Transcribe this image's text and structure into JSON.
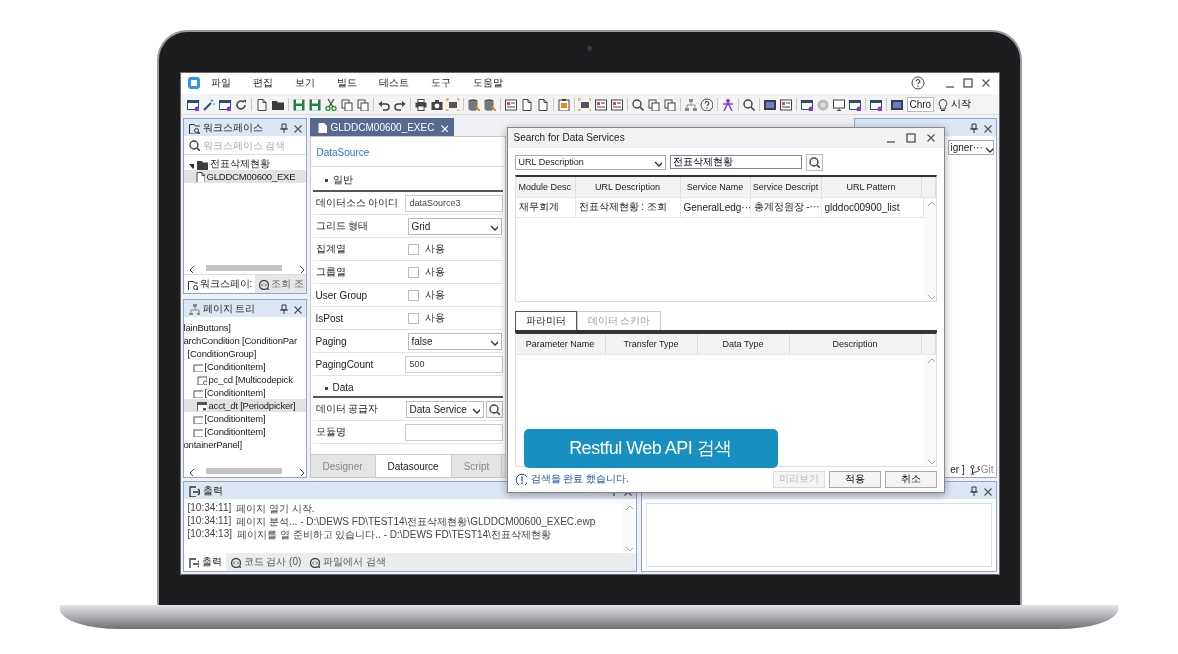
{
  "menu": [
    "파일",
    "편집",
    "보기",
    "빌드",
    "테스트",
    "도구",
    "도움말"
  ],
  "toolbar": {
    "browser": "Chro",
    "start_button": "시작"
  },
  "workspace_panel": {
    "title": "워크스페이스",
    "search_placeholder": "워크스페이스 검색",
    "tree": [
      {
        "label": "전표삭제현황",
        "expanded": true,
        "selected": false,
        "children": [
          {
            "label": "GLDDCM00600_EXE",
            "selected": true
          }
        ]
      }
    ],
    "tabs": [
      {
        "label": "워크스페이:",
        "selected": true
      },
      {
        "label": "조회 조",
        "selected": false
      }
    ]
  },
  "page_tree": {
    "title": "페이지 트리",
    "items": [
      {
        "label": "lainButtons]",
        "selected": false
      },
      {
        "label": "archCondition [ConditionPar",
        "selected": false,
        "children": [
          {
            "label": "[ConditionGroup]",
            "selected": false,
            "children": [
              {
                "label": "[ConditionItem]",
                "kind": "item",
                "selected": false,
                "children": [
                  {
                    "label": "pc_cd [Multicodepick",
                    "kind": "picker",
                    "selected": false
                  }
                ]
              },
              {
                "label": "[ConditionItem]",
                "kind": "item",
                "selected": false,
                "children": [
                  {
                    "label": "acct_dt [Periodpicker]",
                    "kind": "calendar",
                    "selected": true
                  }
                ]
              },
              {
                "label": "[ConditionItem]",
                "kind": "item",
                "selected": false
              },
              {
                "label": "[ConditionItem]",
                "kind": "item",
                "selected": false
              }
            ]
          }
        ]
      },
      {
        "label": "ontainerPanel]",
        "selected": false
      }
    ]
  },
  "editor": {
    "tab": "GLDDCM00600_EXEC",
    "heading": "DataSource",
    "sections": [
      {
        "title": "일반",
        "rows": [
          {
            "kind": "text",
            "label": "데이터소스 아이디",
            "value": "dataSource3"
          },
          {
            "kind": "select",
            "label": "그리드 형태",
            "value": "Grid"
          },
          {
            "kind": "check",
            "label": "집계열",
            "option": "사용",
            "checked": false
          },
          {
            "kind": "check",
            "label": "그룹열",
            "option": "사용",
            "checked": false
          },
          {
            "kind": "check",
            "label": "User Group",
            "option": "사용",
            "checked": false
          },
          {
            "kind": "check",
            "label": "IsPost",
            "option": "사용",
            "checked": false
          },
          {
            "kind": "select",
            "label": "Paging",
            "value": "false"
          },
          {
            "kind": "text",
            "label": "PagingCount",
            "value": "500"
          }
        ]
      },
      {
        "title": "Data",
        "rows": [
          {
            "kind": "select_search",
            "label": "데이터 공급자",
            "value": "Data Service"
          },
          {
            "kind": "text",
            "label": "모듈명"
          }
        ]
      }
    ],
    "bottom_tabs": [
      {
        "label": "Designer",
        "selected": false
      },
      {
        "label": "Datasource",
        "selected": true
      },
      {
        "label": "Script",
        "selected": false
      }
    ]
  },
  "properties_panel": {
    "dropdown": "igner···",
    "tabs": [
      {
        "label": "er ]",
        "selected": true
      },
      {
        "label": "Git",
        "selected": false
      }
    ]
  },
  "output_panel": {
    "title": "출력",
    "lines": [
      {
        "time": "[10:34:11]",
        "message": "페이지 열기 시작."
      },
      {
        "time": "[10:34:11]",
        "message": "페이지 분석... - D:\\DEWS FD\\TEST14\\전표삭제현황\\GLDDCM00600_EXEC.ewp"
      },
      {
        "time": "[10:34:13]",
        "message": "페이지를 열 준비하고 있습니다.. - D:\\DEWS FD\\TEST14\\전표삭제현황"
      }
    ],
    "tabs": [
      {
        "label": "출력",
        "selected": true
      },
      {
        "label": "코드 검사 (0)",
        "selected": false
      },
      {
        "label": "파일에서 검색",
        "selected": false
      }
    ]
  },
  "dialog": {
    "title": "Search for Data Services",
    "search_field": "URL Description",
    "search_value": "전표삭제현황",
    "columns": [
      "Module Desc",
      "URL Description",
      "Service Name",
      "Service Descript",
      "URL Pattern"
    ],
    "rows": [
      [
        "재무회계",
        "전표삭제현황 : 조회",
        "GeneralLedg···",
        "총계정원장 -···",
        "glddoc00900_list"
      ]
    ],
    "tabs": [
      {
        "label": "파라미터",
        "selected": true
      },
      {
        "label": "데이터 스키마",
        "selected": false
      }
    ],
    "param_columns": [
      "Parameter Name",
      "Transfer Type",
      "Data Type",
      "Description"
    ],
    "status": "검색을 완료 했습니다.",
    "buttons": [
      {
        "label": "미리보기",
        "disabled": true
      },
      {
        "label": "적용",
        "disabled": false
      },
      {
        "label": "취소",
        "disabled": false
      }
    ]
  },
  "caption": "Restful Web API 검색"
}
